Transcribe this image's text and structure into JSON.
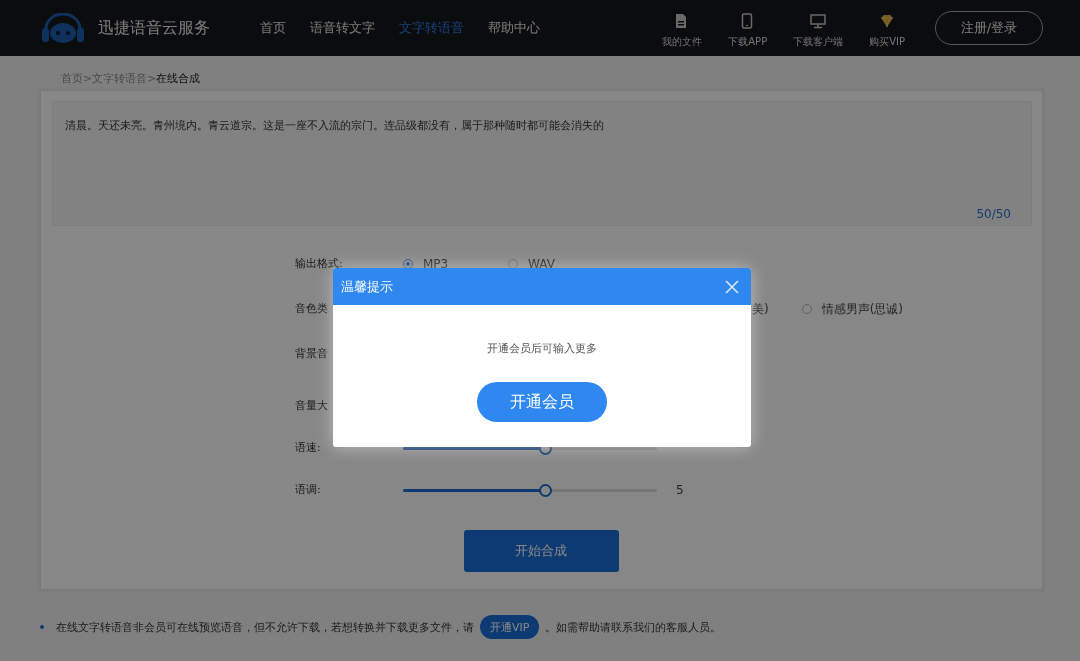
{
  "header": {
    "logo_text": "迅捷语音云服务",
    "nav": [
      {
        "label": "首页",
        "selected": false
      },
      {
        "label": "语音转文字",
        "selected": false
      },
      {
        "label": "文字转语音",
        "selected": true
      },
      {
        "label": "帮助中心",
        "selected": false
      }
    ],
    "tools": [
      {
        "kind": "file",
        "label": "我的文件"
      },
      {
        "kind": "phone",
        "label": "下载APP"
      },
      {
        "kind": "monitor",
        "label": "下载客户端"
      },
      {
        "kind": "diamond",
        "label": "购买VIP"
      }
    ],
    "login_button": "注册/登录"
  },
  "breadcrumb": {
    "separator": ">",
    "items": [
      {
        "label": "首页",
        "current": false
      },
      {
        "label": "文字转语音",
        "current": false
      },
      {
        "label": "在线合成",
        "current": true
      }
    ]
  },
  "editor": {
    "value": "清晨。天还未亮。青州境内。青云道宗。这是一座不入流的宗门。连品级都没有，属于那种随时都可能会消失的",
    "counter": "50/50"
  },
  "form": {
    "rows": [
      {
        "kind": "radio",
        "label": "输出格式:",
        "options": [
          {
            "label": "MP3",
            "selected": true
          },
          {
            "label": "WAV",
            "selected": false
          }
        ]
      },
      {
        "kind": "voice",
        "label": "音色类",
        "fragment": "美)",
        "options": [
          {
            "label": "情感男声(思诚)",
            "selected": false
          }
        ]
      },
      {
        "kind": "plain",
        "label": "背景音"
      },
      {
        "kind": "plain",
        "label": "音量大"
      },
      {
        "kind": "slider",
        "label": "语速:",
        "level": 0.56
      },
      {
        "kind": "slider",
        "label": "语调:",
        "level": 0.56,
        "reading": "5"
      }
    ],
    "submit": "开始合成"
  },
  "note": {
    "before": "在线文字转语音非会员可在线预览语音，但不允许下载，若想转换并下载更多文件，请",
    "button": "开通VIP",
    "after": "。如需帮助请联系我们的客服人员。"
  },
  "dialog": {
    "title": "温馨提示",
    "message": "开通会员后可输入更多",
    "button": "开通会员"
  }
}
